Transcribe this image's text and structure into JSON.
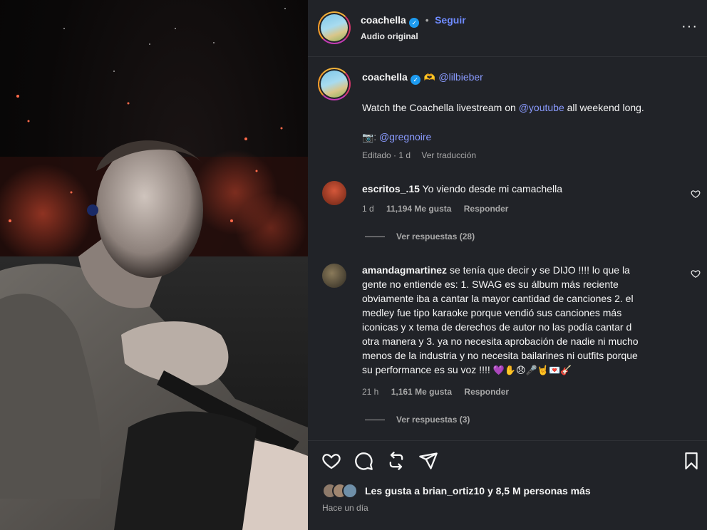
{
  "header": {
    "username": "coachella",
    "follow_label": "Seguir",
    "subtitle": "Audio original",
    "dot": "•"
  },
  "caption": {
    "username": "coachella",
    "mention_bieber": "@lilbieber",
    "text_before": "Watch the Coachella livestream on",
    "mention_youtube": "@youtube",
    "text_after": "all weekend long.",
    "credit_mention": "@gregnoire",
    "edited_label": "Editado · 1 d",
    "translate_label": "Ver traducción"
  },
  "comments": [
    {
      "username": "escritos_.15",
      "text": "Yo viendo desde mi camachella",
      "time": "1 d",
      "likes": "11,194 Me gusta",
      "reply_label": "Responder",
      "view_replies": "Ver respuestas (28)"
    },
    {
      "username": "amandagmartinez",
      "lines": [
        "se tenía que decir y se DIJO !!!! lo que la",
        "gente no entiende es: 1. SWAG es su álbum más reciente",
        "obviamente iba a cantar la mayor cantidad de canciones 2. el",
        "medley fue tipo karaoke porque vendió sus canciones más",
        "iconicas y x tema de derechos de autor no las podía cantar d",
        "otra manera y 3. ya no necesita aprobación de nadie ni mucho",
        "menos de la industria y no necesita bailarines ni outfits porque",
        "su performance es su voz !!!! "
      ],
      "emojis": "💜✋😞🎤🤘💌🎸",
      "time": "21 h",
      "likes": "1,161 Me gusta",
      "reply_label": "Responder",
      "view_replies": "Ver respuestas (3)"
    }
  ],
  "footer": {
    "likes_text": "Les gusta a brian_ortiz10 y 8,5 M personas más",
    "time_ago": "Hace un día"
  },
  "colors": {
    "panel_bg": "#212328",
    "link_blue": "#8a9bff",
    "verified_blue": "#1d9bf0"
  }
}
